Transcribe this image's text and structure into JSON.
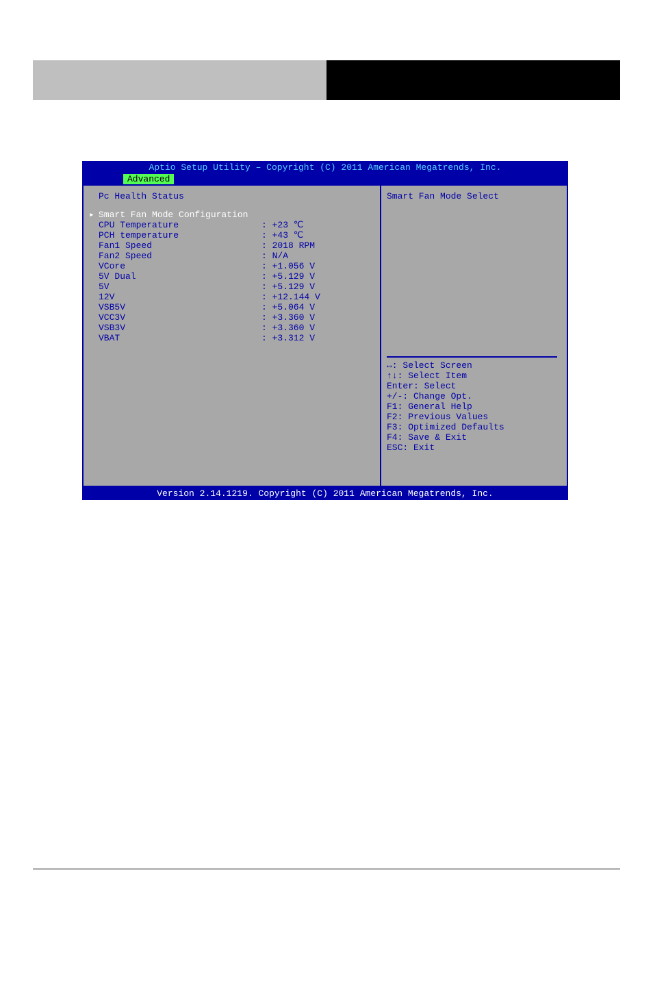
{
  "header": {
    "title": "Aptio Setup Utility – Copyright (C) 2011 American Megatrends, Inc.",
    "active_tab": "Advanced"
  },
  "left_panel": {
    "section_title": "Pc Health Status",
    "selected_item": "Smart Fan Mode Configuration",
    "rows": [
      {
        "label": "CPU Temperature",
        "value": ": +23 ℃"
      },
      {
        "label": "PCH temperature",
        "value": ": +43 ℃"
      },
      {
        "label": "Fan1 Speed",
        "value": ": 2018 RPM"
      },
      {
        "label": "Fan2 Speed",
        "value": ": N/A"
      },
      {
        "label": "VCore",
        "value": ": +1.056 V"
      },
      {
        "label": "5V Dual",
        "value": ": +5.129 V"
      },
      {
        "label": "5V",
        "value": ": +5.129 V"
      },
      {
        "label": "12V",
        "value": ": +12.144 V"
      },
      {
        "label": "VSB5V",
        "value": ": +5.064 V"
      },
      {
        "label": "VCC3V",
        "value": ": +3.360 V"
      },
      {
        "label": "VSB3V",
        "value": ": +3.360 V"
      },
      {
        "label": "VBAT",
        "value": ": +3.312 V"
      }
    ]
  },
  "right_panel": {
    "help_title": "Smart Fan Mode Select",
    "hotkeys": [
      "↔: Select Screen",
      "↑↓: Select Item",
      "Enter: Select",
      "+/-: Change Opt.",
      "F1: General Help",
      "F2: Previous Values",
      "F3: Optimized Defaults",
      "F4: Save & Exit",
      "ESC: Exit"
    ]
  },
  "footer": "Version 2.14.1219. Copyright (C) 2011 American Megatrends, Inc."
}
